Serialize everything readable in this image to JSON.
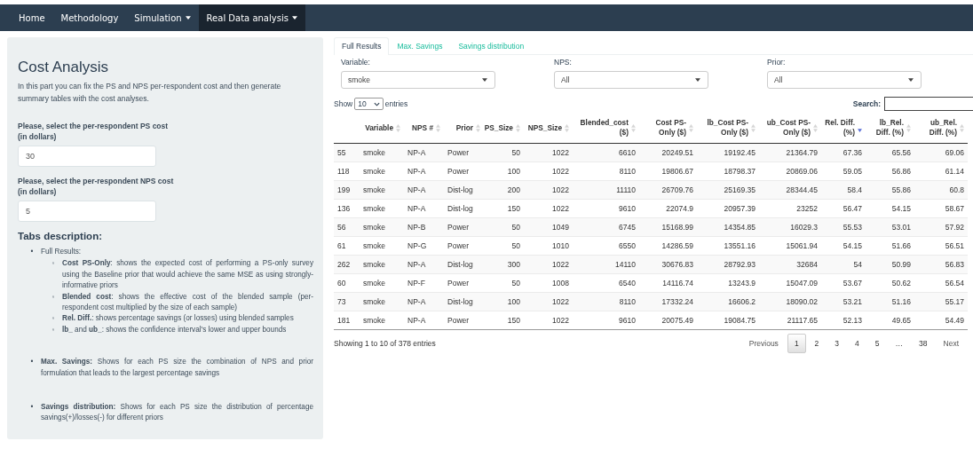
{
  "navbar": {
    "items": [
      {
        "label": "Home",
        "dropdown": false,
        "selected": false
      },
      {
        "label": "Methodology",
        "dropdown": false,
        "selected": false
      },
      {
        "label": "Simulation",
        "dropdown": true,
        "selected": false
      },
      {
        "label": "Real Data analysis",
        "dropdown": true,
        "selected": true
      }
    ]
  },
  "sidebar": {
    "title": "Cost Analysis",
    "intro": "In this part you can fix the PS and NPS per-respondent cost and then generate summary tables with the cost analyses.",
    "fields": [
      {
        "label": "Please, select the per-respondent PS cost (in dollars)",
        "value": "30"
      },
      {
        "label": "Please, select the per-respondent NPS cost (in dollars)",
        "value": "5"
      }
    ],
    "description_title": "Tabs description:",
    "description": [
      {
        "marker": "•",
        "text": "Full Results:",
        "children": [
          {
            "marker": "◦",
            "text": "**Cost PS-Only**: shows the expected cost of performing a PS-only survey using the Baseline prior that would achieve the same MSE as using strongly-informative priors"
          },
          {
            "marker": "◦",
            "text": "**Blended cost**: shows the effective cost of the blended sample (per-respondent cost multiplied by the size of each sample)"
          },
          {
            "marker": "◦",
            "text": "**Rel. Diff.**: shows percentage savings (or losses) using blended samples"
          },
          {
            "marker": "◦",
            "text": "**lb_** and **ub_**: shows the confidence interval's lower and upper bounds"
          }
        ]
      },
      {
        "marker": "•",
        "text": "**Max. Savings:** Shows for each PS size the combination of NPS and prior formulation that leads to the largest percentage savings"
      },
      {
        "marker": "•",
        "text": "**Savings distribution:** Shows for each PS size the distribution of percentage savings(+)/losses(-) for different priors"
      }
    ]
  },
  "main": {
    "tabs": [
      {
        "label": "Full Results",
        "selected": true
      },
      {
        "label": "Max. Savings",
        "selected": false
      },
      {
        "label": "Savings distribution",
        "selected": false
      }
    ],
    "filters": [
      {
        "label": "Variable:",
        "value": "smoke"
      },
      {
        "label": "NPS:",
        "value": "All"
      },
      {
        "label": "Prior:",
        "value": "All"
      }
    ],
    "length": {
      "prefix": "Show",
      "value": "10",
      "suffix": "entries"
    },
    "search_label": "Search:",
    "table": {
      "columns": [
        {
          "label": "Variable",
          "sorted": false
        },
        {
          "label": "NPS #",
          "sorted": false
        },
        {
          "label": "Prior",
          "sorted": false
        },
        {
          "label": "PS_Size",
          "sorted": false
        },
        {
          "label": "NPS_Size",
          "sorted": false
        },
        {
          "label": "Blended_cost ($)",
          "sorted": false
        },
        {
          "label": "Cost PS-Only ($)",
          "sorted": false
        },
        {
          "label": "lb_Cost PS-Only ($)",
          "sorted": false
        },
        {
          "label": "ub_Cost PS-Only ($)",
          "sorted": false
        },
        {
          "label": "Rel. Diff. (%)",
          "sorted": true
        },
        {
          "label": "lb_Rel. Diff. (%)",
          "sorted": false
        },
        {
          "label": "ub_Rel. Diff. (%)",
          "sorted": false
        }
      ],
      "rows": [
        {
          "row_label": "55",
          "cells": [
            "smoke",
            "NP-A",
            "Power",
            "50",
            "1022",
            "6610",
            "20249.51",
            "19192.45",
            "21364.79",
            "67.36",
            "65.56",
            "69.06"
          ]
        },
        {
          "row_label": "118",
          "cells": [
            "smoke",
            "NP-A",
            "Power",
            "100",
            "1022",
            "8110",
            "19806.67",
            "18798.37",
            "20869.06",
            "59.05",
            "56.86",
            "61.14"
          ]
        },
        {
          "row_label": "199",
          "cells": [
            "smoke",
            "NP-A",
            "Dist-log",
            "200",
            "1022",
            "11110",
            "26709.76",
            "25169.35",
            "28344.45",
            "58.4",
            "55.86",
            "60.8"
          ]
        },
        {
          "row_label": "136",
          "cells": [
            "smoke",
            "NP-A",
            "Dist-log",
            "150",
            "1022",
            "9610",
            "22074.9",
            "20957.39",
            "23252",
            "56.47",
            "54.15",
            "58.67"
          ]
        },
        {
          "row_label": "56",
          "cells": [
            "smoke",
            "NP-B",
            "Power",
            "50",
            "1049",
            "6745",
            "15168.99",
            "14354.85",
            "16029.3",
            "55.53",
            "53.01",
            "57.92"
          ]
        },
        {
          "row_label": "61",
          "cells": [
            "smoke",
            "NP-G",
            "Power",
            "50",
            "1010",
            "6550",
            "14286.59",
            "13551.16",
            "15061.94",
            "54.15",
            "51.66",
            "56.51"
          ]
        },
        {
          "row_label": "262",
          "cells": [
            "smoke",
            "NP-A",
            "Dist-log",
            "300",
            "1022",
            "14110",
            "30676.83",
            "28792.93",
            "32684",
            "54",
            "50.99",
            "56.83"
          ]
        },
        {
          "row_label": "60",
          "cells": [
            "smoke",
            "NP-F",
            "Power",
            "50",
            "1008",
            "6540",
            "14116.74",
            "13243.9",
            "15047.09",
            "53.67",
            "50.62",
            "56.54"
          ]
        },
        {
          "row_label": "73",
          "cells": [
            "smoke",
            "NP-A",
            "Dist-log",
            "100",
            "1022",
            "8110",
            "17332.24",
            "16606.2",
            "18090.02",
            "53.21",
            "51.16",
            "55.17"
          ]
        },
        {
          "row_label": "181",
          "cells": [
            "smoke",
            "NP-A",
            "Power",
            "150",
            "1022",
            "9610",
            "20075.49",
            "19084.75",
            "21117.65",
            "52.13",
            "49.65",
            "54.49"
          ]
        }
      ]
    },
    "info": "Showing 1 to 10 of 378 entries",
    "pagination": [
      {
        "label": "Previous",
        "kind": "nav",
        "selected": false
      },
      {
        "label": "1",
        "kind": "page",
        "selected": true
      },
      {
        "label": "2",
        "kind": "page",
        "selected": false
      },
      {
        "label": "3",
        "kind": "page",
        "selected": false
      },
      {
        "label": "4",
        "kind": "page",
        "selected": false
      },
      {
        "label": "5",
        "kind": "page",
        "selected": false
      },
      {
        "label": "…",
        "kind": "ellipsis",
        "selected": false
      },
      {
        "label": "38",
        "kind": "page",
        "selected": false
      },
      {
        "label": "Next",
        "kind": "nav",
        "selected": false
      }
    ]
  }
}
